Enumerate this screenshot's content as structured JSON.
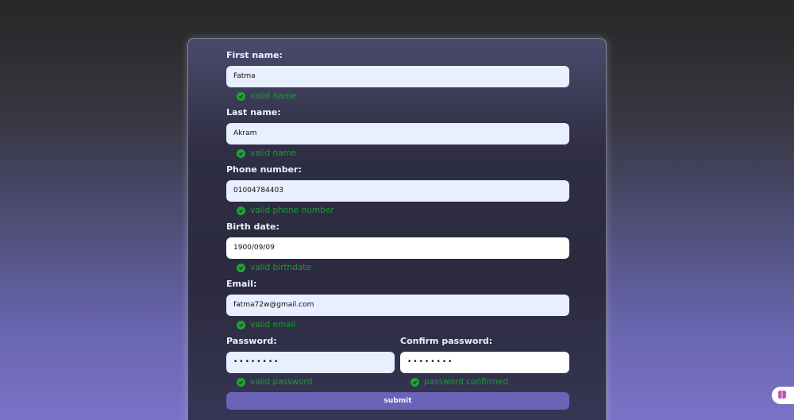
{
  "form": {
    "first_name": {
      "label": "First name:",
      "value": "Fatma",
      "status": "valid name"
    },
    "last_name": {
      "label": "Last name:",
      "value": "Akram",
      "status": "valid name"
    },
    "phone": {
      "label": "Phone number:",
      "value": "01004784403",
      "status": "valid phone number"
    },
    "birth_date": {
      "label": "Birth date:",
      "value": "1900/09/09",
      "status": "valid birthdate"
    },
    "email": {
      "label": "Email:",
      "value": "fatma72w@gmail.com",
      "status": "valid email"
    },
    "password": {
      "label": "Password:",
      "value": "••••••••",
      "status": "valid password"
    },
    "confirm_password": {
      "label": "Confirm password:",
      "value": "••••••••",
      "status": "password confirmed"
    },
    "submit_label": "submit"
  },
  "colors": {
    "valid_green": "#1fa336",
    "input_bg": "#e8efff",
    "submit_bg": "#6a64b8"
  },
  "icons": {
    "status": "check-circle-icon",
    "widget": "brain-icon"
  }
}
